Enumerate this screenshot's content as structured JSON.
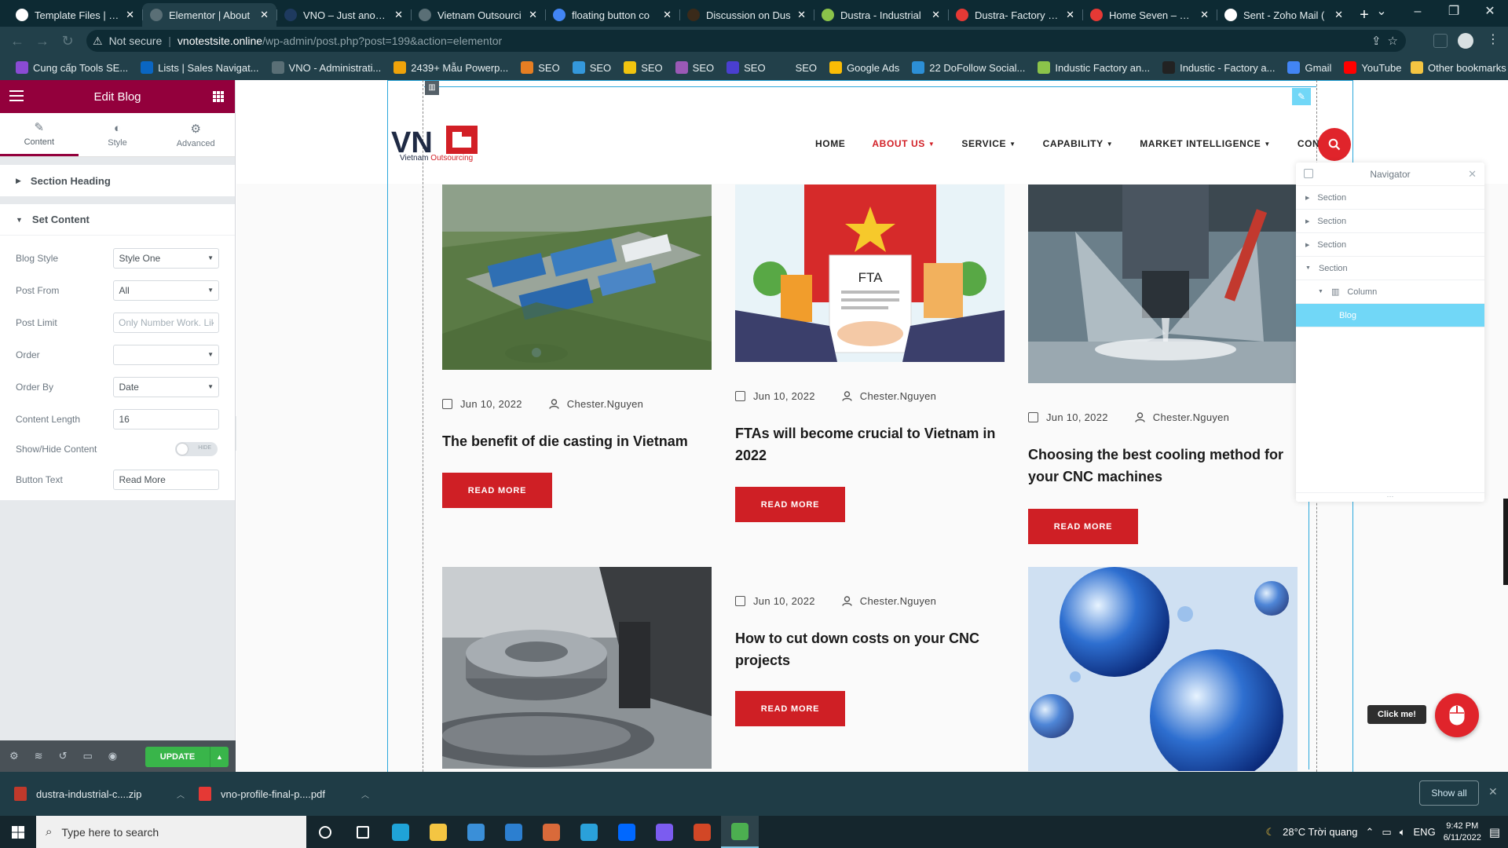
{
  "browser": {
    "tabs": [
      {
        "title": "Template Files | The",
        "color": "#ffffff",
        "icon": "wordpress-icon"
      },
      {
        "title": "Elementor | About",
        "color": "#5a6f76",
        "icon": "elementor-icon",
        "active": true
      },
      {
        "title": "VNO – Just another",
        "color": "#1e3a5f",
        "icon": "vno-icon"
      },
      {
        "title": "Vietnam Outsourci",
        "color": "#5a6f76",
        "icon": "globe-icon"
      },
      {
        "title": "floating button co",
        "color": "#4285f4",
        "icon": "google-icon"
      },
      {
        "title": "Discussion on Dus",
        "color": "#3a2a1a",
        "icon": "themeforest-icon"
      },
      {
        "title": "Dustra - Industrial",
        "color": "#8bc34a",
        "icon": "envato-icon"
      },
      {
        "title": "Dustra- Factory Inc",
        "color": "#e53935",
        "icon": "dustra-icon"
      },
      {
        "title": "Home Seven – Dus",
        "color": "#e53935",
        "icon": "dustra-icon"
      },
      {
        "title": "Sent - Zoho Mail (",
        "color": "#ffffff",
        "icon": "zoho-mail-icon"
      }
    ],
    "new_tab": "+",
    "window_controls": {
      "minimize": "⌄",
      "min": "–",
      "restore": "❐",
      "close": "✕"
    },
    "address": {
      "security": "Not secure",
      "domain": "vnotestsite.online",
      "path": "/wp-admin/post.php?post=199&action=elementor"
    },
    "bookmarks": [
      {
        "label": "Cung cấp Tools SE...",
        "color": "#8a4bd4"
      },
      {
        "label": "Lists | Sales Navigat...",
        "color": "#0a66c2"
      },
      {
        "label": "VNO - Administrati...",
        "color": "#5a6f76"
      },
      {
        "label": "2439+ Mẫu Powerp...",
        "color": "#f0a30a"
      },
      {
        "label": "SEO",
        "color": "#e67e22"
      },
      {
        "label": "SEO",
        "color": "#3498db"
      },
      {
        "label": "SEO",
        "color": "#f1c40f"
      },
      {
        "label": "SEO",
        "color": "#9b59b6"
      },
      {
        "label": "SEO",
        "color": "#4a3fd0"
      },
      {
        "label": "SEO",
        "color": "#22404a"
      },
      {
        "label": "Google Ads",
        "color": "#fbbc05"
      },
      {
        "label": "22 DoFollow Social...",
        "color": "#2c8fd6"
      },
      {
        "label": "Industic Factory an...",
        "color": "#8bc34a"
      },
      {
        "label": "Industic - Factory a...",
        "color": "#222222"
      },
      {
        "label": "Gmail",
        "color": "#4285f4"
      },
      {
        "label": "YouTube",
        "color": "#ff0000"
      }
    ],
    "other_bookmarks": "Other bookmarks"
  },
  "panel": {
    "title": "Edit Blog",
    "tabs": [
      {
        "label": "Content",
        "icon": "pencil-icon",
        "glyph": "✎",
        "active": true
      },
      {
        "label": "Style",
        "icon": "contrast-icon",
        "glyph": "◐"
      },
      {
        "label": "Advanced",
        "icon": "gear-icon",
        "glyph": "⚙"
      }
    ],
    "section_heading": "Section Heading",
    "set_content": "Set Content",
    "fields": {
      "blog_style": {
        "label": "Blog Style",
        "value": "Style One"
      },
      "post_from": {
        "label": "Post From",
        "value": "All"
      },
      "post_limit": {
        "label": "Post Limit",
        "placeholder": "Only Number Work. Lik"
      },
      "order": {
        "label": "Order",
        "value": ""
      },
      "order_by": {
        "label": "Order By",
        "value": "Date"
      },
      "content_length": {
        "label": "Content Length",
        "value": "16"
      },
      "show_hide": {
        "label": "Show/Hide Content",
        "toggle_text": "HIDE"
      },
      "button_text": {
        "label": "Button Text",
        "value": "Read More"
      }
    },
    "footer": {
      "update": "UPDATE"
    }
  },
  "site": {
    "logo": {
      "mark": "VNO",
      "tagline_1": "Vietnam ",
      "tagline_2": "Outsourcing"
    },
    "nav": [
      {
        "label": "HOME",
        "has_dropdown": false
      },
      {
        "label": "ABOUT US",
        "has_dropdown": true,
        "active": true
      },
      {
        "label": "SERVICE",
        "has_dropdown": true
      },
      {
        "label": "CAPABILITY",
        "has_dropdown": true
      },
      {
        "label": "MARKET INTELLIGENCE",
        "has_dropdown": true
      },
      {
        "label": "CONTACT",
        "has_dropdown": false
      }
    ],
    "posts": [
      {
        "date": "Jun 10, 2022",
        "author": "Chester.Nguyen",
        "title": "The benefit of die casting in Vietnam",
        "button": "READ MORE",
        "image": "industrial-park-aerial"
      },
      {
        "date": "Jun 10, 2022",
        "author": "Chester.Nguyen",
        "title": "FTAs will become crucial to Vietnam in 2022",
        "button": "READ MORE",
        "image": "fta-handshake-illustration",
        "image_text": "FTA"
      },
      {
        "date": "Jun 10, 2022",
        "author": "Chester.Nguyen",
        "title": "Choosing the best cooling method for your CNC machines",
        "button": "READ MORE",
        "image": "cnc-coolant-spray"
      },
      {
        "date": "",
        "author": "",
        "title": "",
        "button": "",
        "image": "cnc-gear-cutting"
      },
      {
        "date": "Jun 10, 2022",
        "author": "Chester.Nguyen",
        "title": "How to cut down costs on your CNC projects",
        "button": "READ MORE",
        "image": ""
      },
      {
        "date": "",
        "author": "",
        "title": "",
        "button": "",
        "image": "blue-glass-spheres"
      }
    ]
  },
  "navigator": {
    "title": "Navigator",
    "items": [
      {
        "label": "Section"
      },
      {
        "label": "Section"
      },
      {
        "label": "Section"
      },
      {
        "label": "Section",
        "expanded": true
      },
      {
        "label": "Column",
        "expanded": true
      },
      {
        "label": "Blog",
        "selected": true
      }
    ]
  },
  "floating": {
    "tooltip": "Click me!"
  },
  "downloads": {
    "items": [
      {
        "name": "dustra-industrial-c....zip",
        "color": "#c0392b"
      },
      {
        "name": "vno-profile-final-p....pdf",
        "color": "#e53935"
      }
    ],
    "show_all": "Show all"
  },
  "taskbar": {
    "search_placeholder": "Type here to search",
    "apps": [
      {
        "name": "cortana-icon",
        "color": "#15262d"
      },
      {
        "name": "task-view-icon",
        "color": "#15262d"
      },
      {
        "name": "edge-icon",
        "color": "#1fa3d8"
      },
      {
        "name": "file-explorer-icon",
        "color": "#f4c542"
      },
      {
        "name": "store-icon",
        "color": "#3a8fd8"
      },
      {
        "name": "mail-icon",
        "color": "#2c7fd0"
      },
      {
        "name": "paint-icon",
        "color": "#d96a3a"
      },
      {
        "name": "telegram-icon",
        "color": "#2aa1da"
      },
      {
        "name": "zalo-icon",
        "color": "#0068ff"
      },
      {
        "name": "vpn-icon",
        "color": "#7b5cf0"
      },
      {
        "name": "powerpoint-icon",
        "color": "#d24726"
      },
      {
        "name": "chrome-icon",
        "color": "#4caf50",
        "active": true
      }
    ],
    "weather": "28°C  Trời quang",
    "language": "ENG",
    "time": "9:42 PM",
    "date": "6/11/2022"
  }
}
